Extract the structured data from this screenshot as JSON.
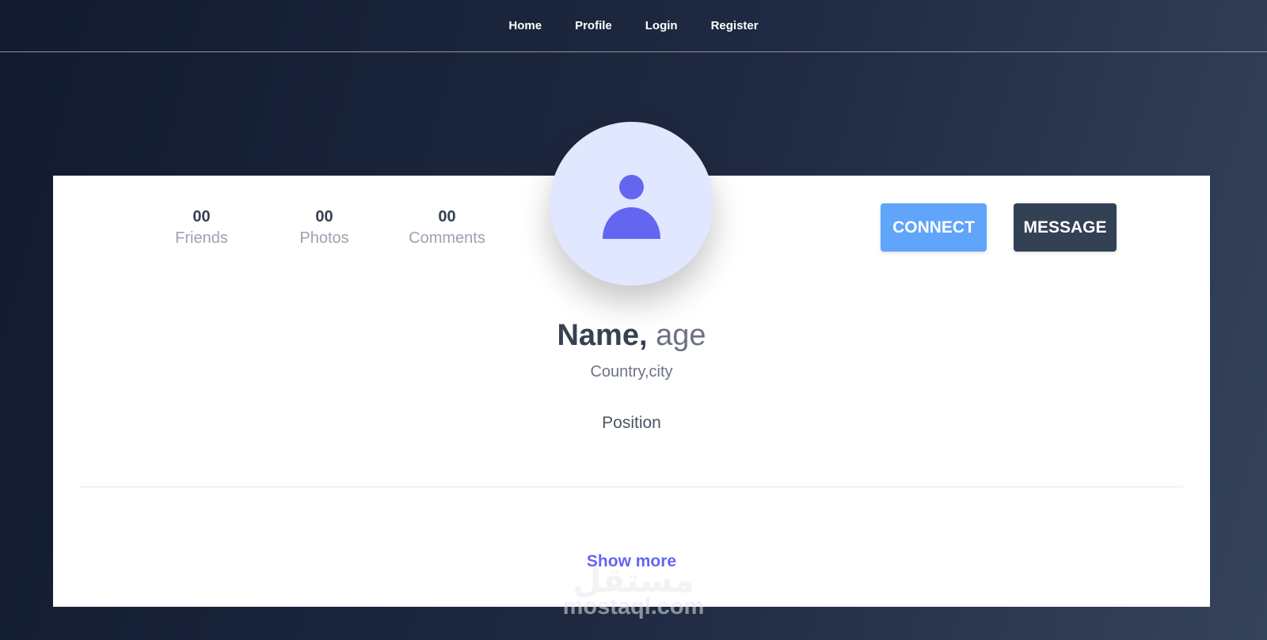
{
  "nav": {
    "items": [
      {
        "label": "Home"
      },
      {
        "label": "Profile"
      },
      {
        "label": "Login"
      },
      {
        "label": "Register"
      }
    ]
  },
  "stats": [
    {
      "value": "00",
      "label": "Friends"
    },
    {
      "value": "00",
      "label": "Photos"
    },
    {
      "value": "00",
      "label": "Comments"
    }
  ],
  "actions": {
    "connect_label": "CONNECT",
    "message_label": "MESSAGE"
  },
  "profile": {
    "name": "Name,",
    "age": "age",
    "location": "Country,city",
    "position": "Position",
    "avatar_icon": "user-icon"
  },
  "show_more_label": "Show more",
  "watermark": {
    "logo_text": "مستقل",
    "text": "mostaql.com"
  },
  "colors": {
    "accent": "#6366f1",
    "connect": "#60a5fa",
    "message": "#334155",
    "avatar_bg": "#e0e7ff"
  }
}
